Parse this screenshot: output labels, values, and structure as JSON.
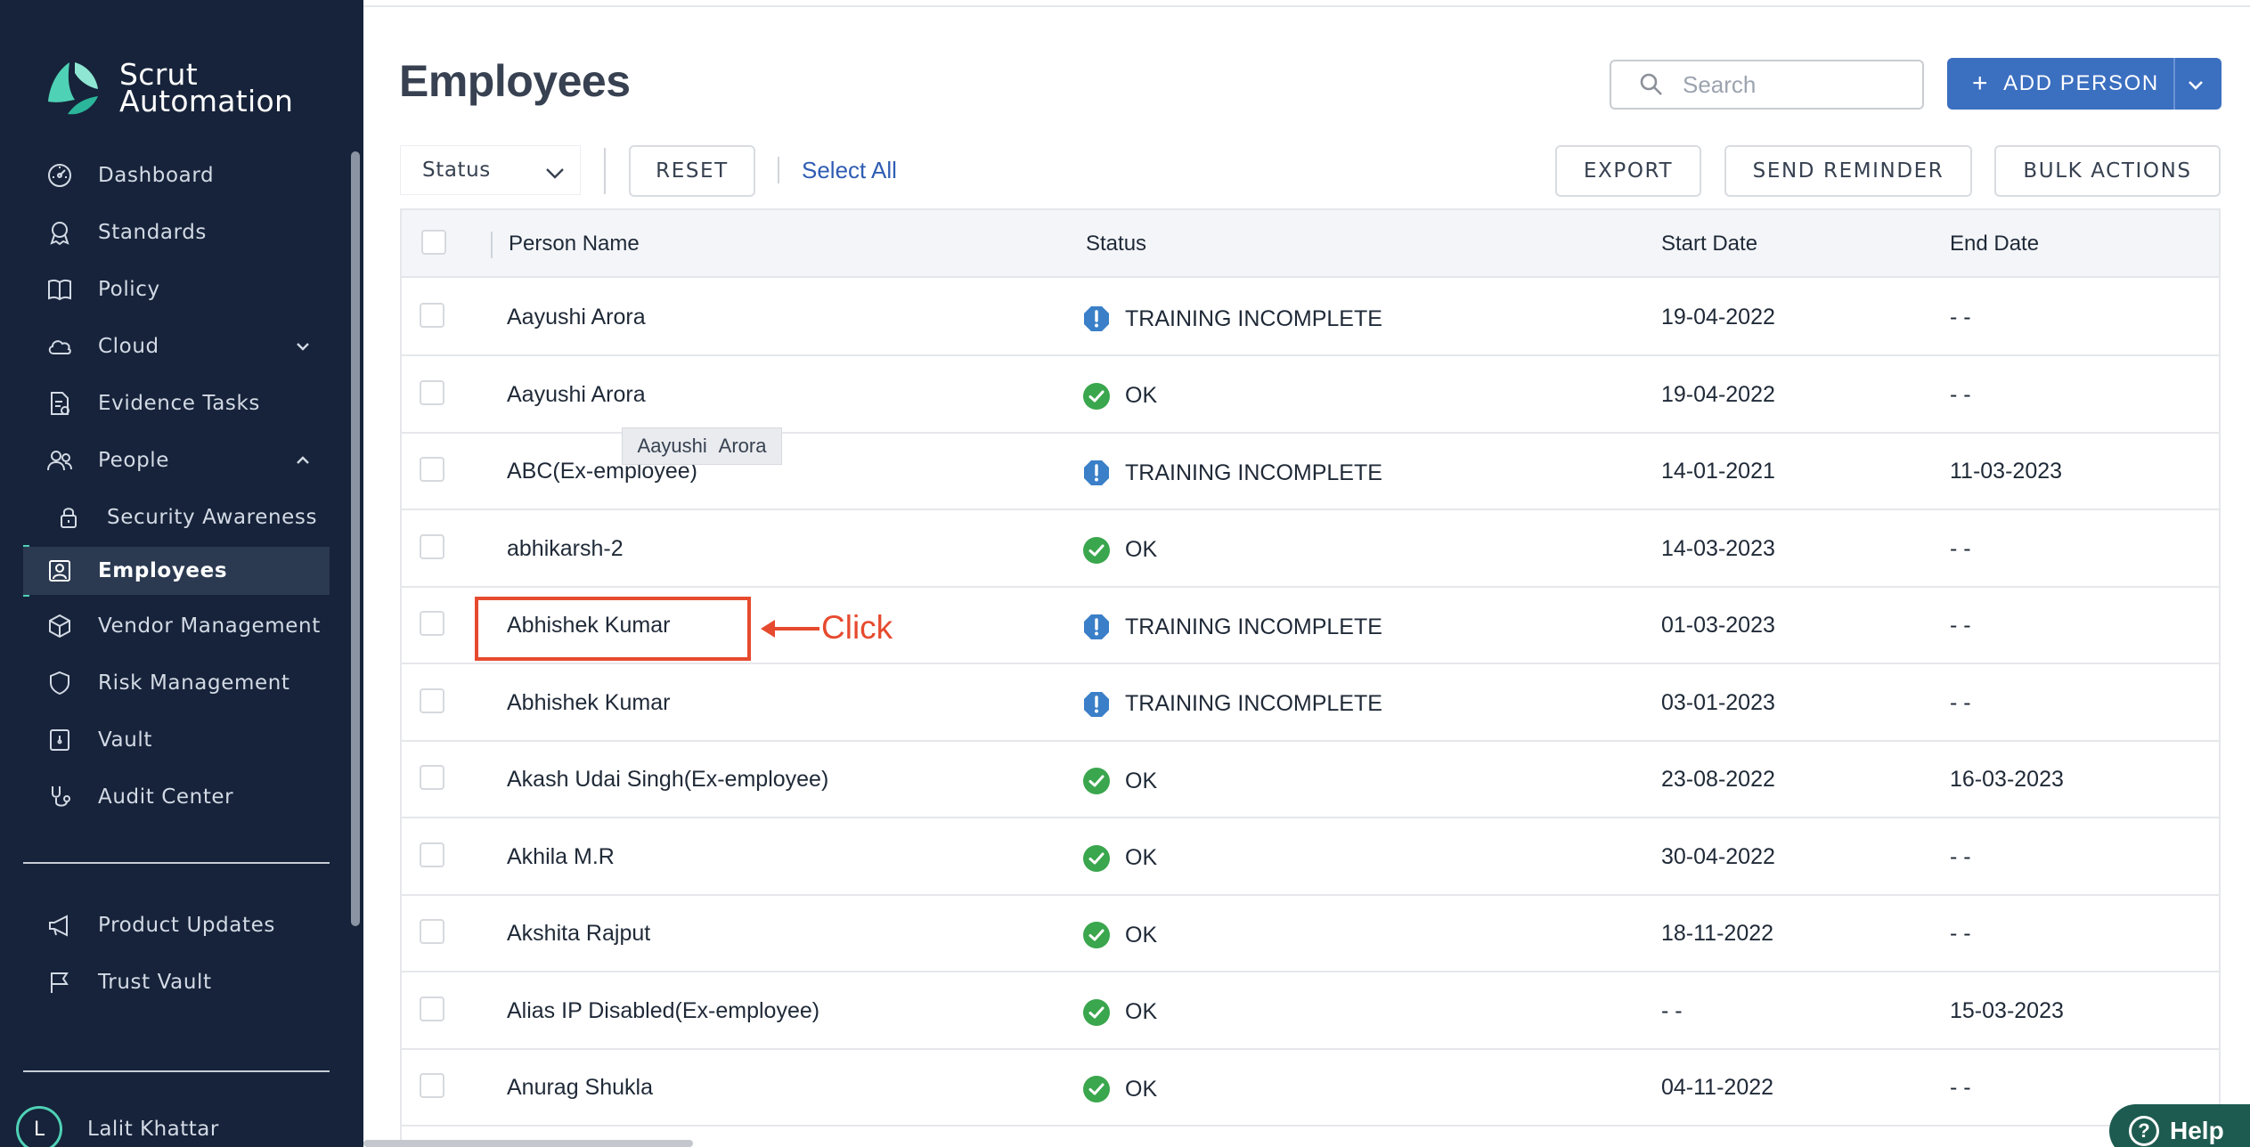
{
  "brand": {
    "line1": "Scrut",
    "line2": "Automation"
  },
  "sidebar": {
    "items": [
      {
        "label": "Dashboard",
        "icon": "dashboard-icon"
      },
      {
        "label": "Standards",
        "icon": "award-icon"
      },
      {
        "label": "Policy",
        "icon": "book-icon"
      },
      {
        "label": "Cloud",
        "icon": "cloud-icon"
      },
      {
        "label": "Evidence Tasks",
        "icon": "document-icon"
      },
      {
        "label": "People",
        "icon": "people-icon"
      },
      {
        "label": "Security Awareness",
        "icon": "lock-icon"
      },
      {
        "label": "Employees",
        "icon": "person-badge-icon"
      },
      {
        "label": "Vendor Management",
        "icon": "box-icon"
      },
      {
        "label": "Risk Management",
        "icon": "shield-icon"
      },
      {
        "label": "Vault",
        "icon": "vault-icon"
      },
      {
        "label": "Audit Center",
        "icon": "stethoscope-icon"
      }
    ],
    "bottom_items": [
      {
        "label": "Product Updates",
        "icon": "megaphone-icon"
      },
      {
        "label": "Trust Vault",
        "icon": "flag-icon"
      }
    ],
    "user": {
      "initial": "L",
      "name": "Lalit Khattar"
    }
  },
  "page": {
    "title": "Employees"
  },
  "search": {
    "placeholder": "Search"
  },
  "toolbar": {
    "add_person": "ADD PERSON",
    "status_filter": "Status",
    "reset": "RESET",
    "select_all": "Select All",
    "export": "EXPORT",
    "send_reminder": "SEND REMINDER",
    "bulk_actions": "BULK ACTIONS"
  },
  "table": {
    "headers": [
      "Person Name",
      "Status",
      "Start Date",
      "End Date"
    ],
    "rows": [
      {
        "name": "Aayushi Arora",
        "status": "TRAINING INCOMPLETE",
        "start": "19-04-2022",
        "end": "- -"
      },
      {
        "name": "Aayushi Arora",
        "status": "OK",
        "start": "19-04-2022",
        "end": "- -"
      },
      {
        "name": "ABC(Ex-employee)",
        "status": "TRAINING INCOMPLETE",
        "start": "14-01-2021",
        "end": "11-03-2023"
      },
      {
        "name": "abhikarsh-2",
        "status": "OK",
        "start": "14-03-2023",
        "end": "- -"
      },
      {
        "name": "Abhishek Kumar",
        "status": "TRAINING INCOMPLETE",
        "start": "01-03-2023",
        "end": "- -"
      },
      {
        "name": "Abhishek Kumar",
        "status": "TRAINING INCOMPLETE",
        "start": "03-01-2023",
        "end": "- -"
      },
      {
        "name": "Akash Udai Singh(Ex-employee)",
        "status": "OK",
        "start": "23-08-2022",
        "end": "16-03-2023"
      },
      {
        "name": "Akhila M.R",
        "status": "OK",
        "start": "30-04-2022",
        "end": "- -"
      },
      {
        "name": "Akshita Rajput",
        "status": "OK",
        "start": "18-11-2022",
        "end": "- -"
      },
      {
        "name": "Alias IP Disabled(Ex-employee)",
        "status": "OK",
        "start": "- -",
        "end": "15-03-2023"
      },
      {
        "name": "Anurag Shukla",
        "status": "OK",
        "start": "04-11-2022",
        "end": "- -"
      }
    ]
  },
  "tooltip": {
    "text": "Aayushi Arora"
  },
  "annotation": {
    "label": "Click"
  },
  "help": {
    "label": "Help"
  },
  "colors": {
    "sidebar_bg": "#16233a",
    "accent": "#4fd1b5",
    "primary": "#3b6fc0",
    "ok": "#3aa64d",
    "warn": "#3a7fc8",
    "annotation": "#e64a2e"
  }
}
